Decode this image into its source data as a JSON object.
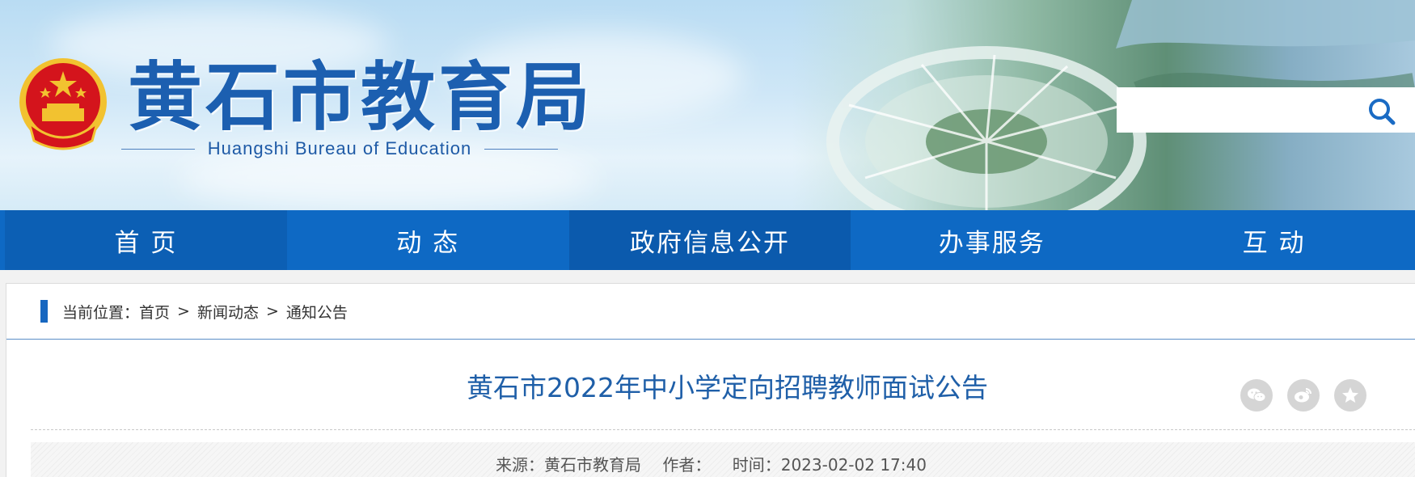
{
  "header": {
    "site_title": "黄石市教育局",
    "site_subtitle": "Huangshi Bureau of Education",
    "search": {
      "placeholder": "",
      "value": ""
    }
  },
  "nav": {
    "items": [
      {
        "label": "首 页"
      },
      {
        "label": "动 态"
      },
      {
        "label": "政府信息公开"
      },
      {
        "label": "办事服务"
      },
      {
        "label": "互 动"
      }
    ]
  },
  "breadcrumb": {
    "prefix": "当前位置：",
    "items": [
      "首页",
      "新闻动态",
      "通知公告"
    ],
    "separator": ">"
  },
  "article": {
    "title": "黄石市2022年中小学定向招聘教师面试公告",
    "source_label": "来源：",
    "source": "黄石市教育局",
    "author_label": "作者：",
    "author": "",
    "time_label": "时间：",
    "time": "2023-02-02 17:40"
  },
  "share": {
    "icons": [
      "wechat-icon",
      "weibo-icon",
      "favorite-star-icon"
    ]
  },
  "colors": {
    "nav_bg": "#0e69c4",
    "title_blue": "#1c5fb0",
    "article_title": "#1f5fa8",
    "emblem_red": "#d4141c",
    "emblem_gold": "#f2c230"
  }
}
